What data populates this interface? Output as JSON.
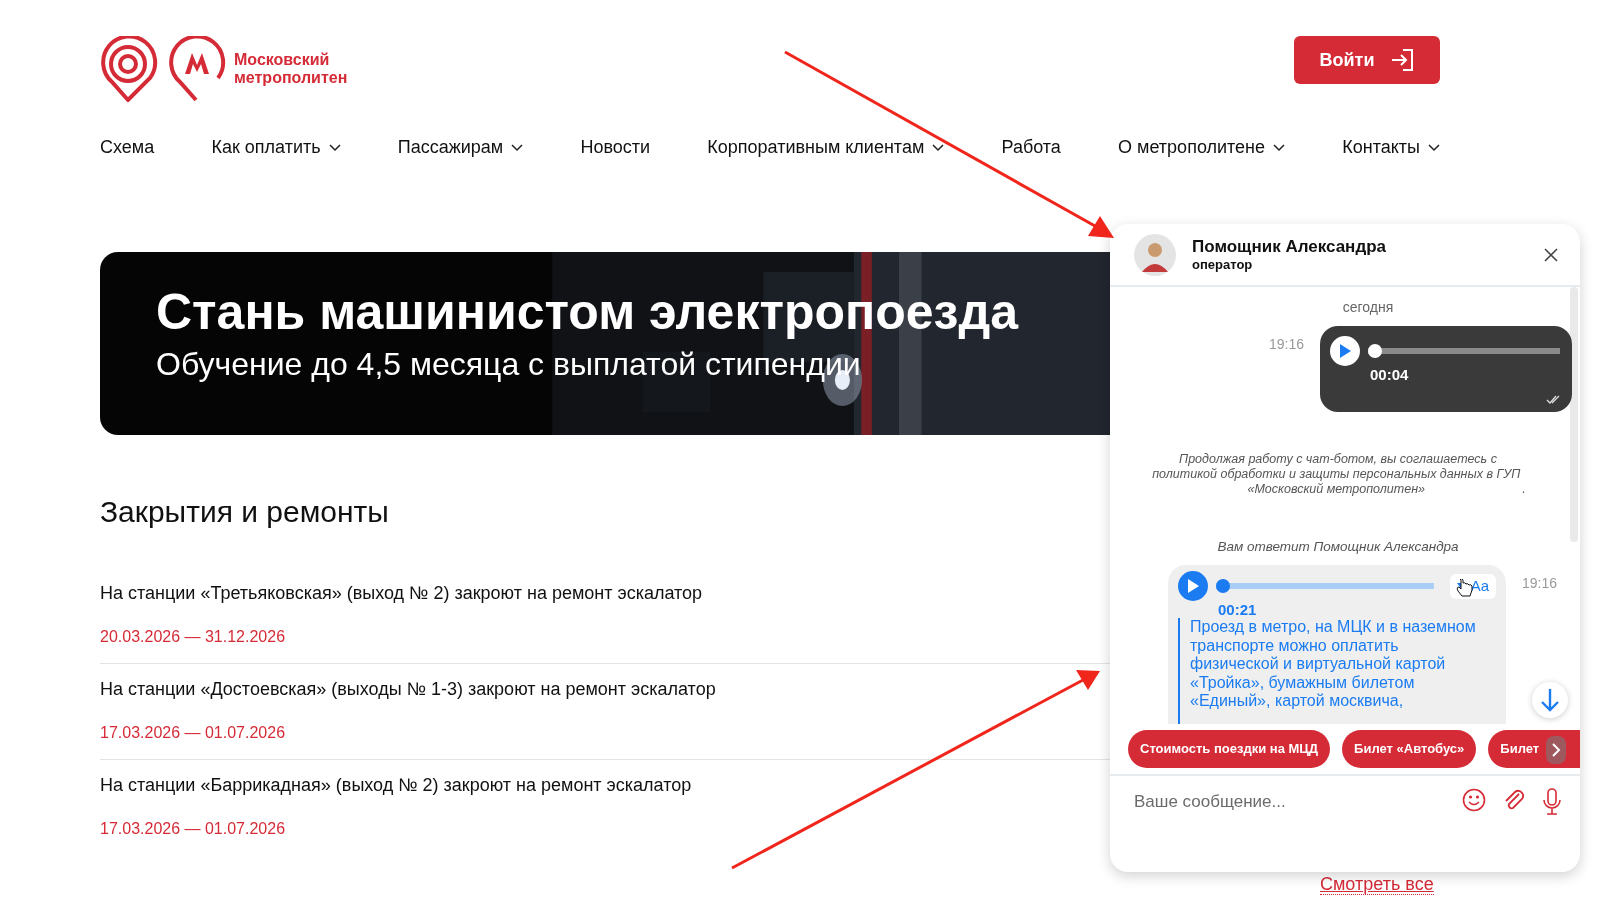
{
  "logo": {
    "lines": [
      "Московский",
      "метрополитен"
    ]
  },
  "login_button": {
    "label": "Войти"
  },
  "nav": [
    {
      "label": "Схема",
      "dropdown": false
    },
    {
      "label": "Как оплатить",
      "dropdown": true
    },
    {
      "label": "Пассажирам",
      "dropdown": true
    },
    {
      "label": "Новости",
      "dropdown": false
    },
    {
      "label": "Корпоративным клиентам",
      "dropdown": true
    },
    {
      "label": "Работа",
      "dropdown": false
    },
    {
      "label": "О метрополитене",
      "dropdown": true
    },
    {
      "label": "Контакты",
      "dropdown": true
    }
  ],
  "banner": {
    "title": "Стань машинистом электропоезда",
    "subtitle": "Обучение до 4,5 месяца с выплатой стипендии"
  },
  "closures": {
    "heading": "Закрытия и ремонты",
    "items": [
      {
        "title": "На станции «Третьяковская» (выход № 2) закроют на ремонт эскалатор",
        "dates": "20.03.2026 — 31.12.2026"
      },
      {
        "title": "На станции «Достоевская» (выходы № 1-3) закроют на ремонт эскалатор",
        "dates": "17.03.2026 — 01.07.2026"
      },
      {
        "title": "На станции «Баррикадная» (выход № 2) закроют на ремонт эскалатор",
        "dates": "17.03.2026 — 01.07.2026"
      }
    ],
    "see_all": "Смотреть все"
  },
  "chat": {
    "operator": {
      "name": "Помощник Александра",
      "role": "оператор"
    },
    "date_label": "сегодня",
    "messages": [
      {
        "kind": "outgoing_voice",
        "time": "19:16",
        "duration": "00:04",
        "level": 0,
        "read": true
      },
      {
        "kind": "notice",
        "text": "Продолжая работу с чат-ботом, вы соглашаетесь с",
        "link": "политикой обработки и защиты персональных данных в ГУП «Московский метрополитен»",
        "after": "."
      },
      {
        "kind": "info",
        "text": "Вам ответит Помощник Александра"
      },
      {
        "kind": "incoming_voice",
        "time": "19:16",
        "duration": "00:21",
        "level": 0,
        "toggle": "Aa",
        "transcript": "Проезд в метро, на МЦК и в наземном транспорте можно оплатить физической и виртуальной картой «Тройка», бумажным билетом «Единый», картой москвича,"
      }
    ],
    "quick_replies": [
      {
        "label": "Стоимость поездки на МЦД"
      },
      {
        "label": "Билет «Автобус»"
      },
      {
        "label": "Билет"
      }
    ],
    "input": {
      "placeholder": "Ваше сообщение..."
    }
  }
}
